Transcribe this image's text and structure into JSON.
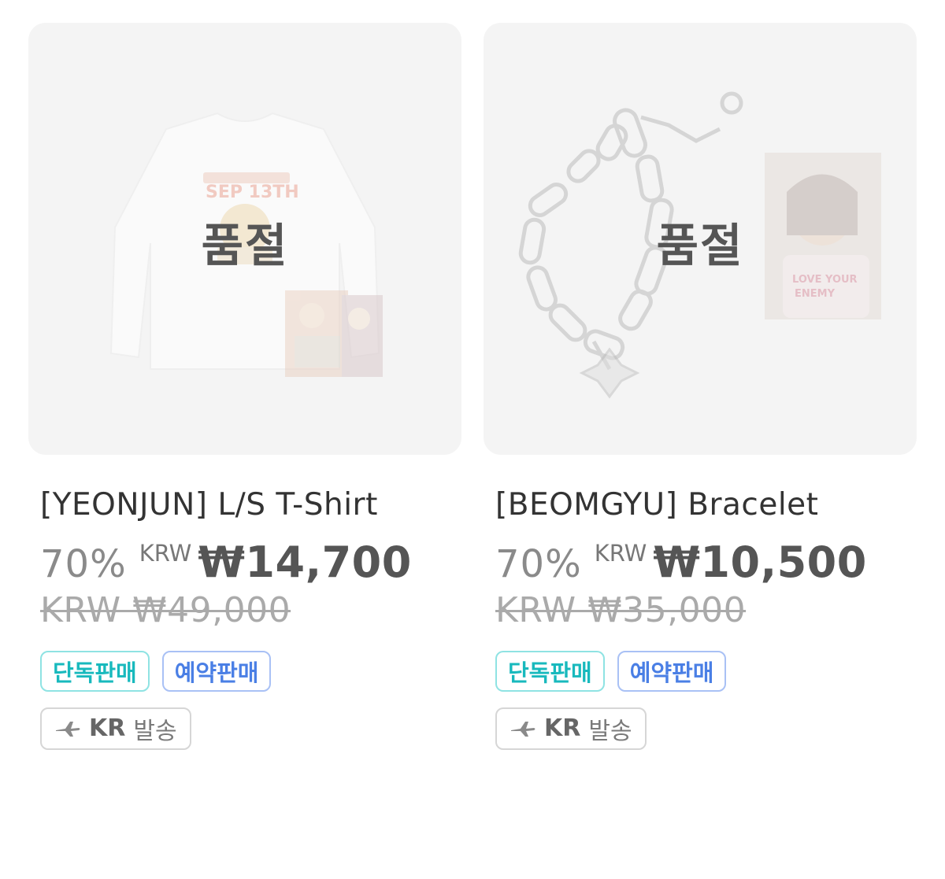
{
  "products": [
    {
      "status": "품절",
      "title": "[YEONJUN] L/S T-Shirt",
      "discount": "70%",
      "currency": "KRW",
      "price": "₩14,700",
      "original_price": "KRW ₩49,000",
      "badges": {
        "exclusive": "단독판매",
        "preorder": "예약판매"
      },
      "shipping": {
        "icon": "airplane-icon",
        "country": "KR",
        "label": "발송"
      }
    },
    {
      "status": "품절",
      "title": "[BEOMGYU] Bracelet",
      "discount": "70%",
      "currency": "KRW",
      "price": "₩10,500",
      "original_price": "KRW ₩35,000",
      "badges": {
        "exclusive": "단독판매",
        "preorder": "예약판매"
      },
      "shipping": {
        "icon": "airplane-icon",
        "country": "KR",
        "label": "발송"
      }
    }
  ],
  "colors": {
    "exclusive": "#18b9bd",
    "preorder": "#4a7fe5"
  }
}
